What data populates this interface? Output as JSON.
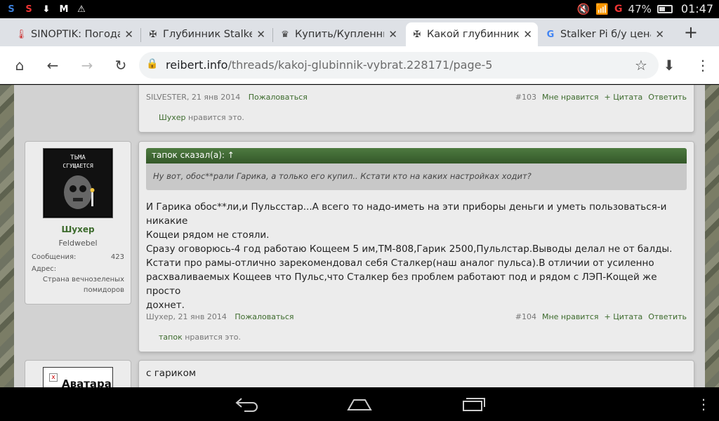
{
  "status_bar": {
    "battery": "47%",
    "time": "01:47",
    "signal_label": "G"
  },
  "tabs": [
    {
      "title": "SINOPTIK: Погода",
      "icon": "thermometer-icon"
    },
    {
      "title": "Глубинник Stalker",
      "icon": "cross-icon"
    },
    {
      "title": "Купить/Купленны",
      "icon": "crown-icon"
    },
    {
      "title": "Какой глубинник",
      "icon": "cross-icon",
      "active": true
    },
    {
      "title": "Stalker Pi б/у цена",
      "icon": "google-icon"
    }
  ],
  "toolbar": {
    "url_domain": "reibert.info",
    "url_path": "/threads/kakoj-glubinnik-vybrat.228171/page-5"
  },
  "posts": [
    {
      "author": "SILVESTER",
      "date": "21 янв 2014",
      "report": "Пожаловаться",
      "number": "#103",
      "like": "Мне нравится",
      "quote": "+ Цитата",
      "reply": "Ответить",
      "liked_by": "Шухер",
      "liked_suffix": "нравится это."
    },
    {
      "user": {
        "avatar_text": "ТЬМА СГУЩАЕТСЯ",
        "name": "Шухер",
        "rank": "Feldwebel",
        "messages_label": "Сообщения:",
        "messages_value": "423",
        "address_label": "Адрес:",
        "address_value_1": "Страна вечнозеленых",
        "address_value_2": "помидоров"
      },
      "quote_header": "тапок сказал(а): ↑",
      "quote_body": "Ну вот, обос**рали Гарика, а только его купил.. Кстати кто на каких настройках ходит?",
      "text_lines": [
        "И Гарика обос**ли,и Пульсстар...А всего то надо-иметь на эти приборы деньги и уметь пользоваться-и никакие",
        "Кощеи рядом не стояли.",
        "Сразу оговорюсь-4 год работаю Кощеем 5 им,ТМ-808,Гарик 2500,Пульлстар.Выводы делал не от балды.",
        "Кстати про рамы-отлично зарекомендовал себя Сталкер(наш аналог пульса).В отличии от усиленно",
        "расхваливаемых Кощеев что Пульс,что Сталкер без проблем работают под и рядом с ЛЭП-Кощей же просто",
        "дохнет."
      ],
      "author": "Шухер",
      "date": "21 янв 2014",
      "report": "Пожаловаться",
      "number": "#104",
      "like": "Мне нравится",
      "quote": "+ Цитата",
      "reply": "Ответить",
      "liked_by": "тапок",
      "liked_suffix": "нравится это."
    },
    {
      "user": {
        "avatar_text": "Аватара"
      },
      "text": "с гариком"
    }
  ]
}
